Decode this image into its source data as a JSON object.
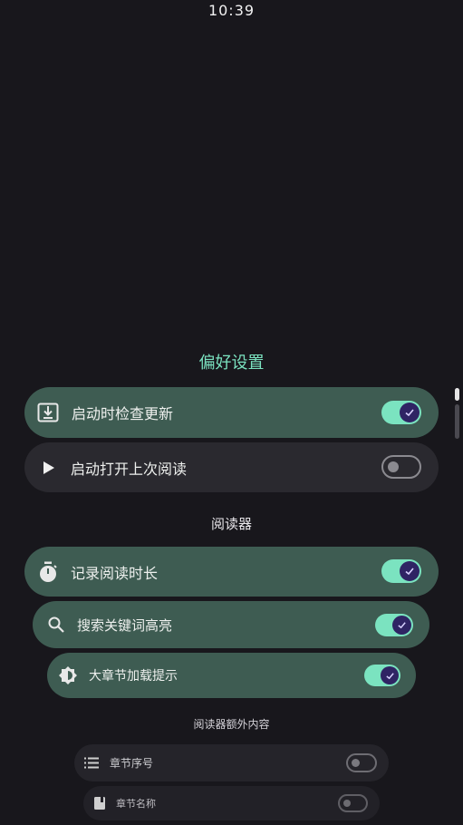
{
  "status_bar": {
    "time": "10:39"
  },
  "preferences": {
    "title": "偏好设置",
    "items": [
      {
        "label": "启动时检查更新",
        "icon": "download-box-icon",
        "enabled": true
      },
      {
        "label": "启动打开上次阅读",
        "icon": "play-icon",
        "enabled": false
      }
    ]
  },
  "reader": {
    "title": "阅读器",
    "items": [
      {
        "label": "记录阅读时长",
        "icon": "timer-icon",
        "enabled": true
      },
      {
        "label": "搜索关键词高亮",
        "icon": "search-icon",
        "enabled": true
      },
      {
        "label": "大章节加载提示",
        "icon": "brightness-icon",
        "enabled": true
      }
    ]
  },
  "reader_extra": {
    "title": "阅读器额外内容",
    "items": [
      {
        "label": "章节序号",
        "icon": "list-icon",
        "enabled": false
      },
      {
        "label": "章节名称",
        "icon": "book-icon",
        "enabled": false
      }
    ]
  },
  "colors": {
    "background": "#18171c",
    "accent": "#7be3c0",
    "active_card": "#3e5c52",
    "inactive_card": "#2a292f",
    "section_title": "#7be3c0"
  }
}
